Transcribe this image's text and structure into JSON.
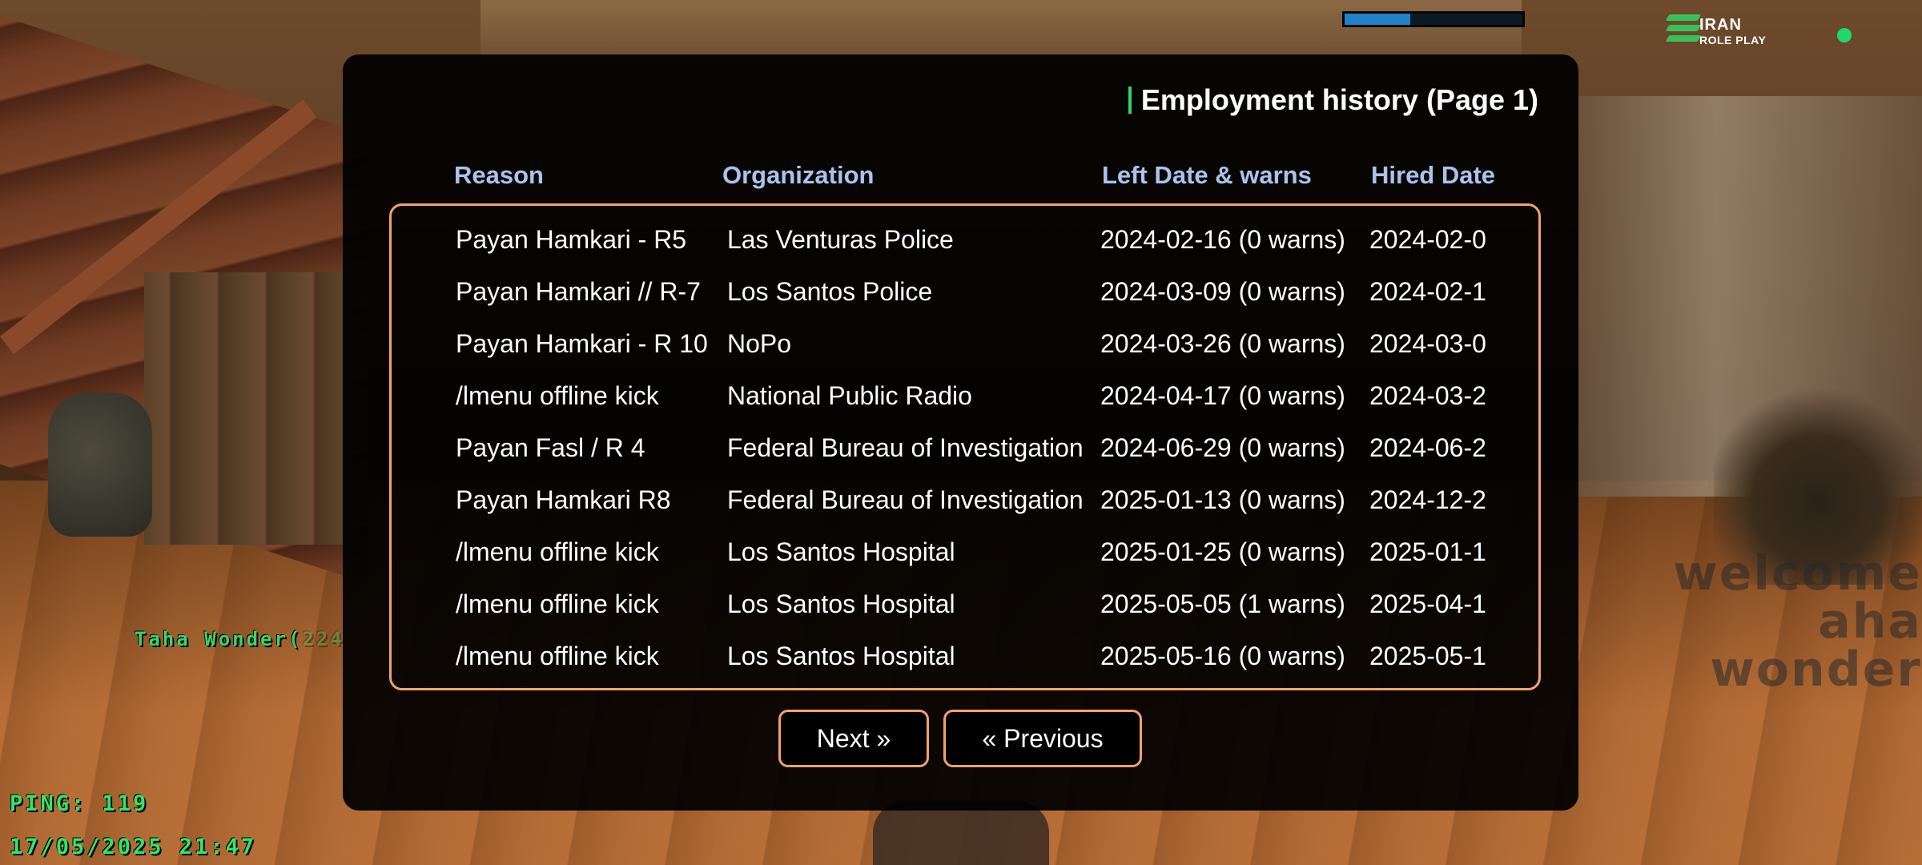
{
  "dialog": {
    "title": "Employment history (Page 1)",
    "columns": {
      "reason": "Reason",
      "organization": "Organization",
      "left_date": "Left Date & warns",
      "hired_date": "Hired Date"
    },
    "rows": [
      {
        "reason": "Payan Hamkari - R5",
        "organization": "Las Venturas Police",
        "left": "2024-02-16 (0 warns)",
        "hired": "2024-02-0"
      },
      {
        "reason": "Payan Hamkari // R-7",
        "organization": "Los Santos Police",
        "left": "2024-03-09 (0 warns)",
        "hired": "2024-02-1"
      },
      {
        "reason": "Payan Hamkari - R 10",
        "organization": "NoPo",
        "left": "2024-03-26 (0 warns)",
        "hired": "2024-03-0"
      },
      {
        "reason": "/lmenu offline kick",
        "organization": "National Public Radio",
        "left": "2024-04-17 (0 warns)",
        "hired": "2024-03-2"
      },
      {
        "reason": "Payan Fasl / R 4",
        "organization": "Federal Bureau of Investigation",
        "left": "2024-06-29 (0 warns)",
        "hired": "2024-06-2"
      },
      {
        "reason": "Payan Hamkari R8",
        "organization": "Federal Bureau of Investigation",
        "left": "2025-01-13 (0 warns)",
        "hired": "2024-12-2"
      },
      {
        "reason": "/lmenu offline kick",
        "organization": "Los Santos Hospital",
        "left": "2025-01-25 (0 warns)",
        "hired": "2025-01-1"
      },
      {
        "reason": "/lmenu offline kick",
        "organization": "Los Santos Hospital",
        "left": "2025-05-05 (1 warns)",
        "hired": "2025-04-1"
      },
      {
        "reason": "/lmenu offline kick",
        "organization": "Los Santos Hospital",
        "left": "2025-05-16 (0 warns)",
        "hired": "2025-05-1"
      }
    ],
    "buttons": {
      "next": "Next »",
      "previous": "« Previous"
    }
  },
  "hud": {
    "logo_line1": "IRAN",
    "logo_line2": "ROLE PLAY",
    "player_tag": "Taha Wonder(",
    "player_tag_faded": "224",
    "ping": "PING: 119",
    "datetime": "17/05/2025 21:47",
    "health_fraction": 0.37,
    "welcome_line1": "welcome",
    "welcome_line2": "aha wonder",
    "colors": {
      "accent": "#f2a26a",
      "scrollbar": "#ed965e",
      "header_text": "#a9c4ec",
      "hud_green": "#2ce86a",
      "health_bar": "#1f83c9"
    }
  }
}
